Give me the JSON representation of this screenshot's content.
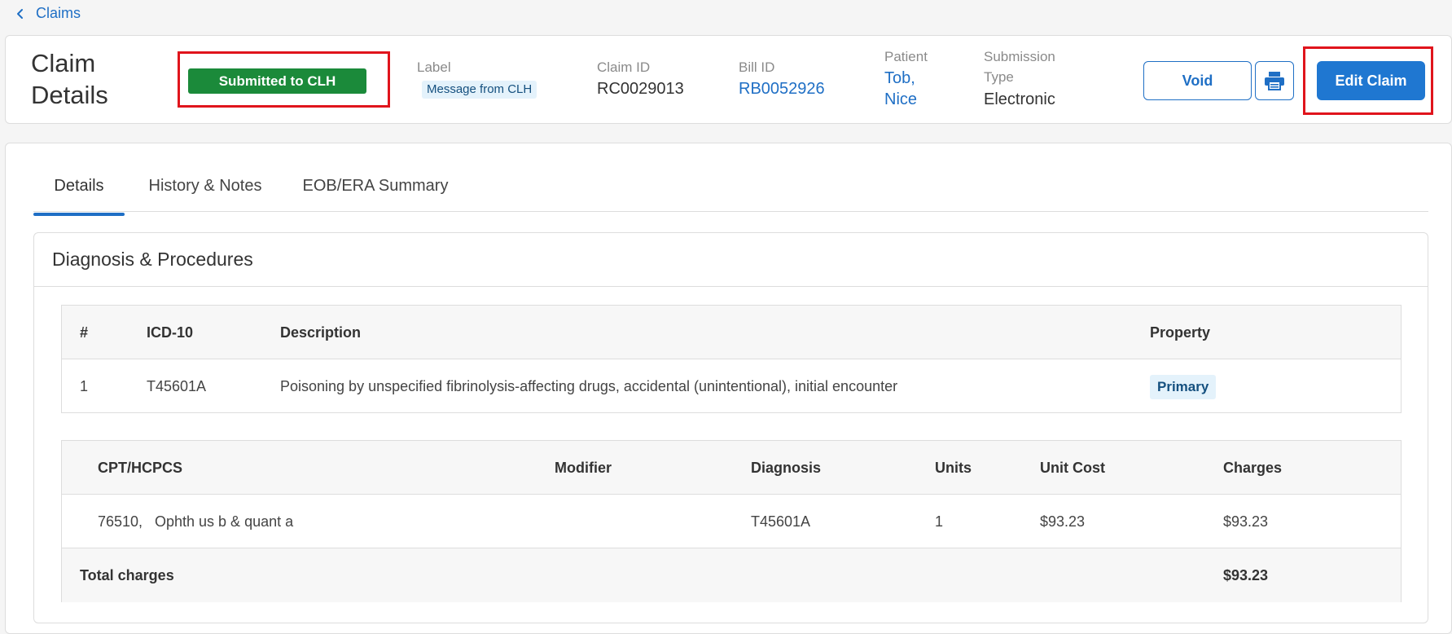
{
  "nav": {
    "back_label": "Claims"
  },
  "header": {
    "title": "Claim Details",
    "status": "Submitted to CLH",
    "label_caption": "Label",
    "label_value": "Message from CLH",
    "claim_id_caption": "Claim ID",
    "claim_id": "RC0029013",
    "bill_id_caption": "Bill ID",
    "bill_id": "RB0052926",
    "patient_caption": "Patient",
    "patient_line1": "Tob,",
    "patient_line2": "Nice",
    "submission_caption_line1": "Submission",
    "submission_caption_line2": "Type",
    "submission_type": "Electronic",
    "void_label": "Void",
    "print_icon": "printer-icon",
    "edit_label": "Edit Claim",
    "status_color": "#1b8a3a",
    "accent_color": "#1f77d1",
    "highlight_color": "#e0141c"
  },
  "tabs": [
    {
      "label": "Details",
      "active": true
    },
    {
      "label": "History & Notes",
      "active": false
    },
    {
      "label": "EOB/ERA Summary",
      "active": false
    }
  ],
  "section": {
    "title": "Diagnosis & Procedures"
  },
  "diagnosis_table": {
    "headers": [
      "#",
      "ICD-10",
      "Description",
      "Property"
    ],
    "rows": [
      {
        "num": "1",
        "code": "T45601A",
        "description": "Poisoning by unspecified fibrinolysis-affecting drugs, accidental (unintentional), initial encounter",
        "property": "Primary"
      }
    ]
  },
  "procedure_table": {
    "headers": [
      "CPT/HCPCS",
      "Modifier",
      "Diagnosis",
      "Units",
      "Unit Cost",
      "Charges"
    ],
    "rows": [
      {
        "cpt": "76510,",
        "cpt_desc": "Ophth us b & quant a",
        "modifier": "",
        "diagnosis": "T45601A",
        "units": "1",
        "unit_cost": "$93.23",
        "charges": "$93.23"
      }
    ],
    "total_label": "Total charges",
    "total_value": "$93.23"
  }
}
